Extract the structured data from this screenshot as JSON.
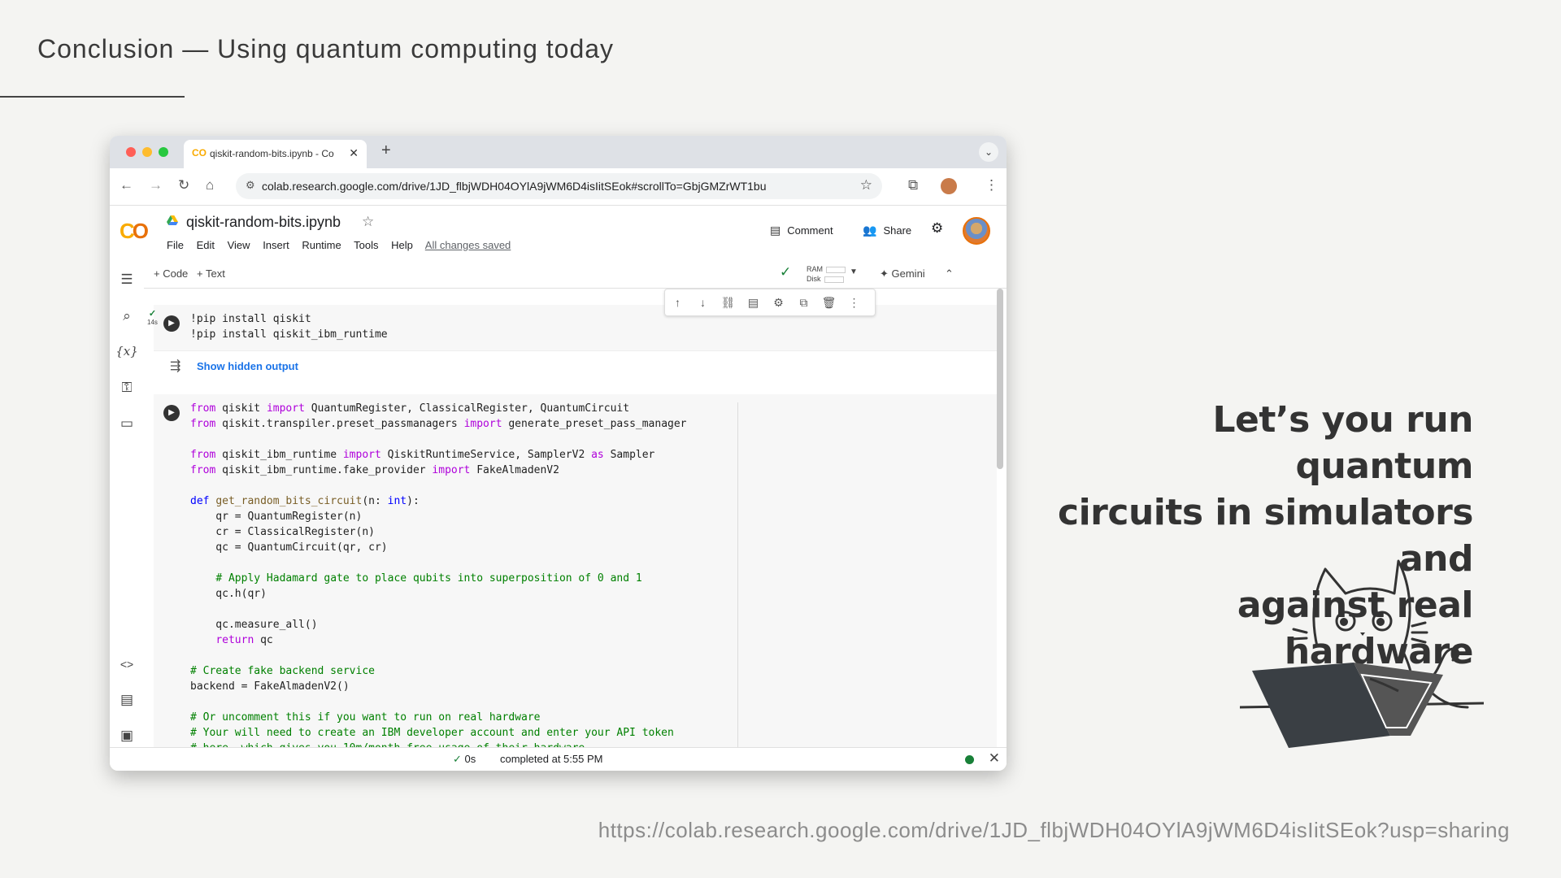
{
  "slide": {
    "title": "Conclusion — Using quantum computing today",
    "tagline": [
      "Let’s you run quantum",
      "circuits in simulators and",
      "against real hardware"
    ],
    "footer_url": "https://colab.research.google.com/drive/1JD_flbjWDH04OYlA9jWM6D4isIitSEok?usp=sharing"
  },
  "browser": {
    "tab_title": "qiskit-random-bits.ipynb - Co",
    "tab_favicon": "CO",
    "address": "colab.research.google.com/drive/1JD_flbjWDH04OYlA9jWM6D4isIitSEok#scrollTo=GbjGMZrWT1bu"
  },
  "colab": {
    "notebook_title": "qiskit-random-bits.ipynb",
    "menu": [
      "File",
      "Edit",
      "View",
      "Insert",
      "Runtime",
      "Tools",
      "Help"
    ],
    "saved_status": "All changes saved",
    "comment_label": "Comment",
    "share_label": "Share",
    "add_code": "+ Code",
    "add_text": "+ Text",
    "ram_label": "RAM",
    "disk_label": "Disk",
    "gemini_label": "Gemini",
    "cell1_time": "14s",
    "show_hidden_output": "Show hidden output",
    "status_time": "0s",
    "status_text": "completed at 5:55 PM"
  },
  "colors": {
    "accent_orange": "#f9ab00",
    "link_blue": "#1a73e8",
    "status_green": "#188038"
  }
}
